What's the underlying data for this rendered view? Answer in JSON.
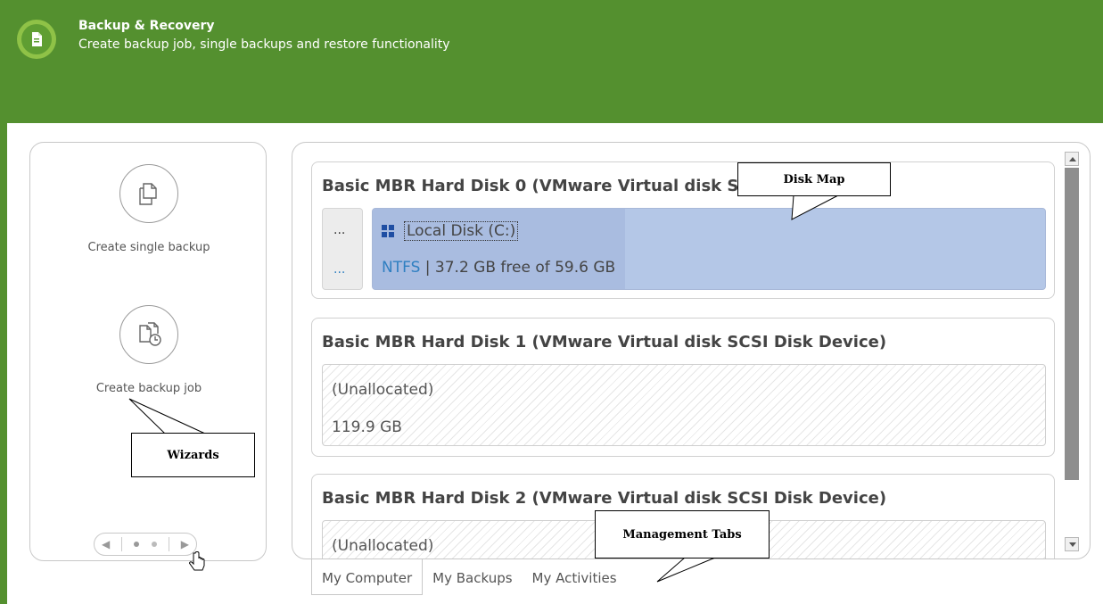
{
  "header": {
    "title": "Backup & Recovery",
    "subtitle": "Create backup job, single backups and restore functionality",
    "icon": "backup-recovery-icon",
    "bg_color": "#54902f"
  },
  "wizards": {
    "items": [
      {
        "label": "Create single backup",
        "icon": "documents-icon"
      },
      {
        "label": "Create backup job",
        "icon": "documents-clock-icon"
      }
    ]
  },
  "disks": [
    {
      "title": "Basic MBR Hard Disk 0 (VMware Virtual disk S",
      "side_dots_top": "...",
      "side_dots_bottom": "...",
      "partition": {
        "name": "Local Disk (C:)",
        "filesystem": "NTFS",
        "info": " | 37.2 GB free of 59.6 GB"
      }
    },
    {
      "title": "Basic MBR Hard Disk 1 (VMware Virtual disk SCSI Disk Device)",
      "unallocated_label": "(Unallocated)",
      "size": "119.9 GB"
    },
    {
      "title": "Basic MBR Hard Disk 2 (VMware Virtual disk SCSI Disk Device)",
      "unallocated_label": "(Unallocated)"
    }
  ],
  "tabs": [
    {
      "label": "My Computer",
      "active": true
    },
    {
      "label": "My Backups",
      "active": false
    },
    {
      "label": "My Activities",
      "active": false
    }
  ],
  "callouts": {
    "disk_map": "Disk Map",
    "wizards": "Wizards",
    "management_tabs": "Management Tabs"
  }
}
